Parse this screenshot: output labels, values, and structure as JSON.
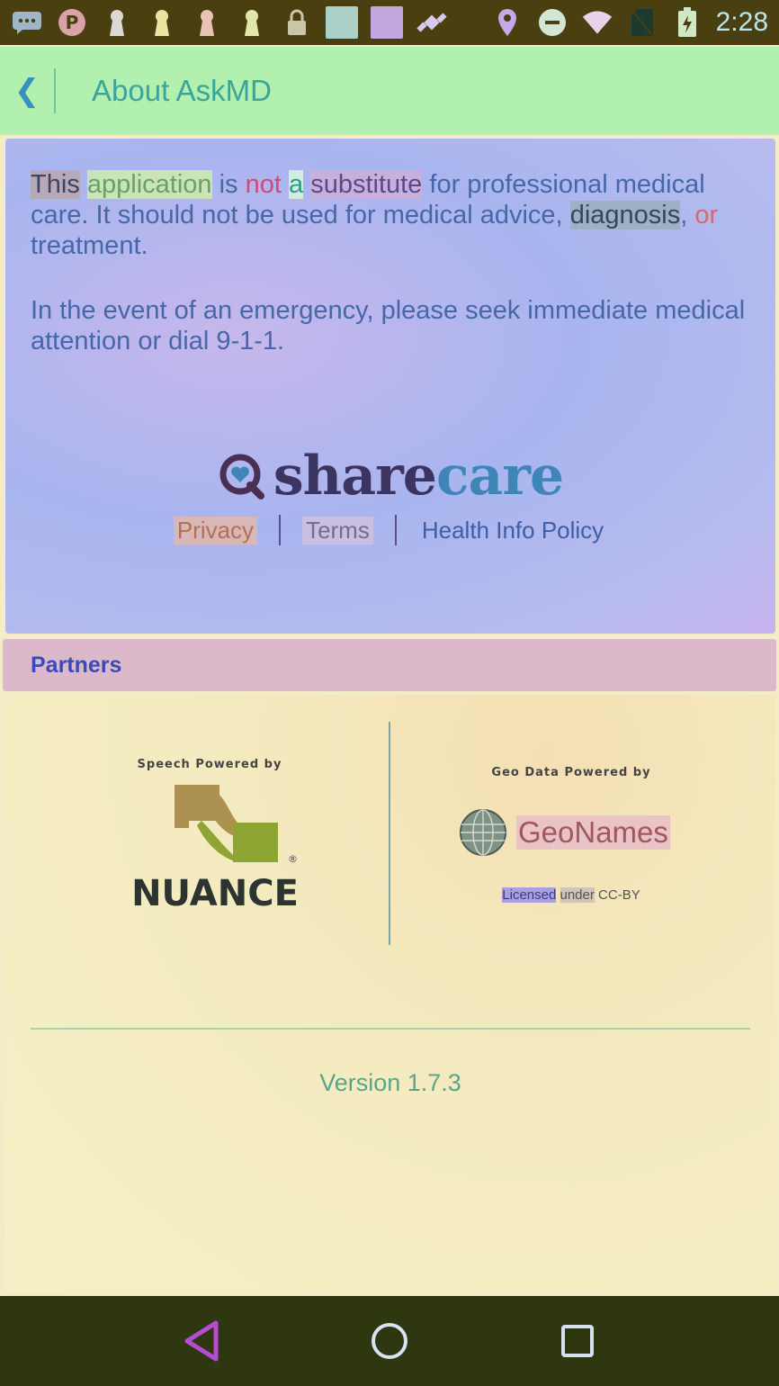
{
  "status_bar": {
    "time": "2:28",
    "icons": [
      "message-icon",
      "pinterest-icon",
      "keyhole-icon",
      "keyhole-icon",
      "keyhole-icon",
      "keyhole-icon",
      "lock-icon",
      "square-icon",
      "square-icon",
      "satellite-icon",
      "location-icon",
      "dnd-icon",
      "wifi-icon",
      "no-sim-icon",
      "battery-icon"
    ]
  },
  "header": {
    "back_icon": "chevron-left-icon",
    "title": "About AskMD"
  },
  "disclaimer": {
    "para1_words": [
      "This",
      "application",
      "is",
      "not",
      "a",
      "substitute",
      "for professional medical care. It should not be used for medical advice,",
      "diagnosis",
      ",",
      "or",
      "treatment."
    ],
    "para2": "In the event of an emergency, please seek immediate medical attention or dial 9-1-1.",
    "brand": {
      "share": "share",
      "care": "care"
    },
    "links": {
      "privacy": "Privacy",
      "terms": "Terms",
      "health": "Health Info Policy"
    }
  },
  "partners": {
    "label": "Partners",
    "speech_caption": "Speech Powered by",
    "nuance_word": "NUANCE",
    "geo_caption": "Geo Data Powered by",
    "geo_word": "GeoNames",
    "license": {
      "a": "Licensed",
      "b": "under",
      "c": "CC-BY"
    }
  },
  "version": "Version 1.7.3",
  "colors": {
    "header_bg": "#b2f0b0",
    "accent": "#3aa59a",
    "status_bar": "#4a3f10",
    "nav_bar": "#2e3710"
  }
}
